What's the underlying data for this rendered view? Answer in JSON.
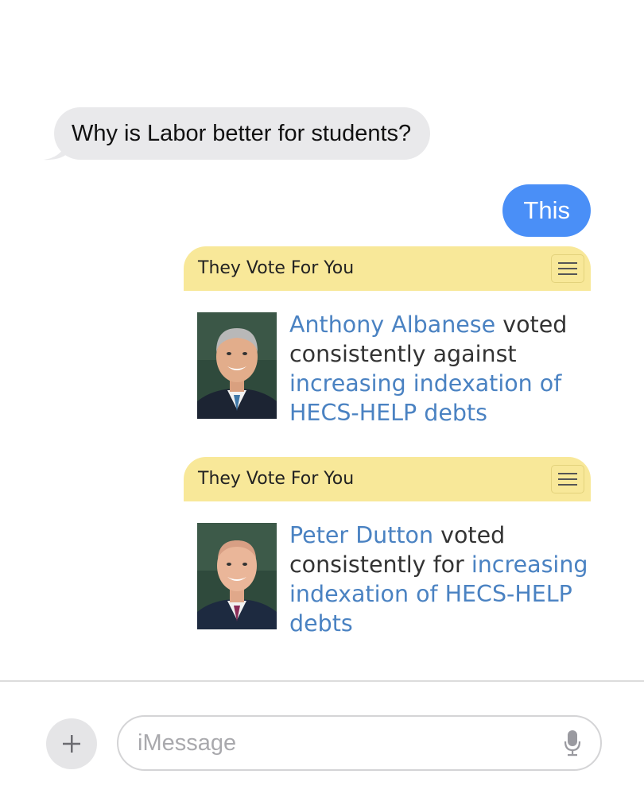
{
  "messages": [
    {
      "direction": "incoming",
      "text": "Why is Labor better for students?"
    },
    {
      "direction": "outgoing",
      "text": "This"
    }
  ],
  "cards": [
    {
      "header": "They Vote For You",
      "person": "Anthony Albanese",
      "verb": " voted consistently against ",
      "policy": "increasing indexation of HECS-HELP debts",
      "portrait_icon": "portrait-photo"
    },
    {
      "header": "They Vote For You",
      "person": "Peter Dutton",
      "verb": " voted consistently for ",
      "policy": "increasing indexation of HECS-HELP debts",
      "portrait_icon": "portrait-photo"
    }
  ],
  "composer": {
    "placeholder": "iMessage",
    "add_icon": "plus-icon",
    "mic_icon": "microphone-icon"
  },
  "colors": {
    "incoming_bubble": "#e9e9eb",
    "outgoing_bubble": "#4a8ff7",
    "card_header": "#f8e899",
    "link": "#4a82c2"
  }
}
